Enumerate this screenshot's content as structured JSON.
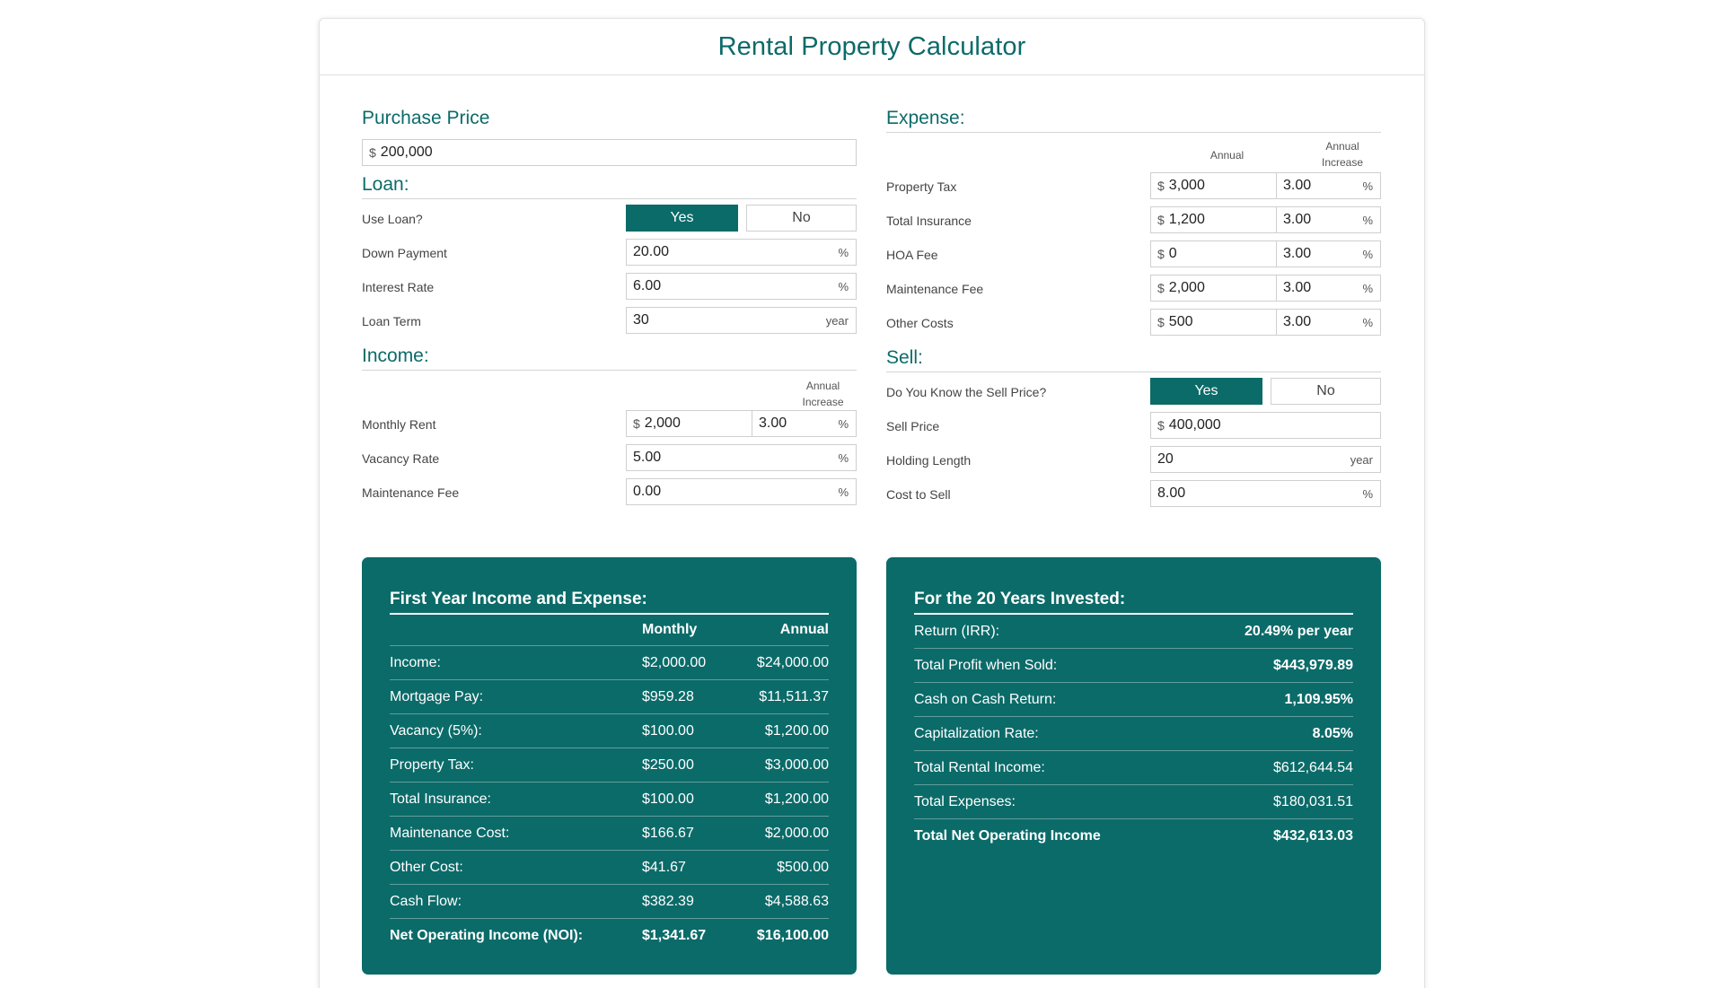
{
  "title": "Rental Property Calculator",
  "purchase": {
    "heading": "Purchase Price",
    "prefix": "$",
    "value": "200,000"
  },
  "loan": {
    "heading": "Loan:",
    "use_label": "Use Loan?",
    "yes": "Yes",
    "no": "No",
    "selected": "Yes",
    "down_label": "Down Payment",
    "down_value": "20.00",
    "down_unit": "%",
    "rate_label": "Interest Rate",
    "rate_value": "6.00",
    "rate_unit": "%",
    "term_label": "Loan Term",
    "term_value": "30",
    "term_unit": "year"
  },
  "income": {
    "heading": "Income:",
    "annual_increase_header": "Annual\nIncrease",
    "rent_label": "Monthly Rent",
    "rent_prefix": "$",
    "rent_value": "2,000",
    "rent_increase": "3.00",
    "rent_increase_unit": "%",
    "vacancy_label": "Vacancy Rate",
    "vacancy_value": "5.00",
    "vacancy_unit": "%",
    "maint_label": "Maintenance Fee",
    "maint_value": "0.00",
    "maint_unit": "%"
  },
  "expense": {
    "heading": "Expense:",
    "annual_header": "Annual",
    "annual_increase_header": "Annual\nIncrease",
    "items": [
      {
        "label": "Property Tax",
        "prefix": "$",
        "value": "3,000",
        "increase": "3.00",
        "unit": "%"
      },
      {
        "label": "Total Insurance",
        "prefix": "$",
        "value": "1,200",
        "increase": "3.00",
        "unit": "%"
      },
      {
        "label": "HOA Fee",
        "prefix": "$",
        "value": "0",
        "increase": "3.00",
        "unit": "%"
      },
      {
        "label": "Maintenance Fee",
        "prefix": "$",
        "value": "2,000",
        "increase": "3.00",
        "unit": "%"
      },
      {
        "label": "Other Costs",
        "prefix": "$",
        "value": "500",
        "increase": "3.00",
        "unit": "%"
      }
    ]
  },
  "sell": {
    "heading": "Sell:",
    "know_label": "Do You Know the Sell Price?",
    "yes": "Yes",
    "no": "No",
    "selected": "Yes",
    "price_label": "Sell Price",
    "price_prefix": "$",
    "price_value": "400,000",
    "holding_label": "Holding Length",
    "holding_value": "20",
    "holding_unit": "year",
    "cost_label": "Cost to Sell",
    "cost_value": "8.00",
    "cost_unit": "%"
  },
  "first_year": {
    "title": "First Year Income and Expense:",
    "col_monthly": "Monthly",
    "col_annual": "Annual",
    "rows": [
      {
        "label": "Income:",
        "monthly": "$2,000.00",
        "annual": "$24,000.00"
      },
      {
        "label": "Mortgage Pay:",
        "monthly": "$959.28",
        "annual": "$11,511.37"
      },
      {
        "label": "Vacancy (5%):",
        "monthly": "$100.00",
        "annual": "$1,200.00"
      },
      {
        "label": "Property Tax:",
        "monthly": "$250.00",
        "annual": "$3,000.00"
      },
      {
        "label": "Total Insurance:",
        "monthly": "$100.00",
        "annual": "$1,200.00"
      },
      {
        "label": "Maintenance Cost:",
        "monthly": "$166.67",
        "annual": "$2,000.00"
      },
      {
        "label": "Other Cost:",
        "monthly": "$41.67",
        "annual": "$500.00"
      },
      {
        "label": "Cash Flow:",
        "monthly": "$382.39",
        "annual": "$4,588.63"
      },
      {
        "label": "Net Operating Income (NOI):",
        "monthly": "$1,341.67",
        "annual": "$16,100.00"
      }
    ]
  },
  "summary": {
    "title": "For the 20 Years Invested:",
    "rows": [
      {
        "label": "Return (IRR):",
        "value": "20.49% per year",
        "bold": true
      },
      {
        "label": "Total Profit when Sold:",
        "value": "$443,979.89",
        "bold": true
      },
      {
        "label": "Cash on Cash Return:",
        "value": "1,109.95%",
        "bold": true
      },
      {
        "label": "Capitalization Rate:",
        "value": "8.05%",
        "bold": true
      },
      {
        "label": "Total Rental Income:",
        "value": "$612,644.54",
        "bold": false
      },
      {
        "label": "Total Expenses:",
        "value": "$180,031.51",
        "bold": false
      },
      {
        "label": "Total Net Operating Income",
        "value": "$432,613.03",
        "bold": true
      }
    ]
  },
  "colors": {
    "accent": "#0b6b69",
    "border": "#cfcfcf"
  }
}
